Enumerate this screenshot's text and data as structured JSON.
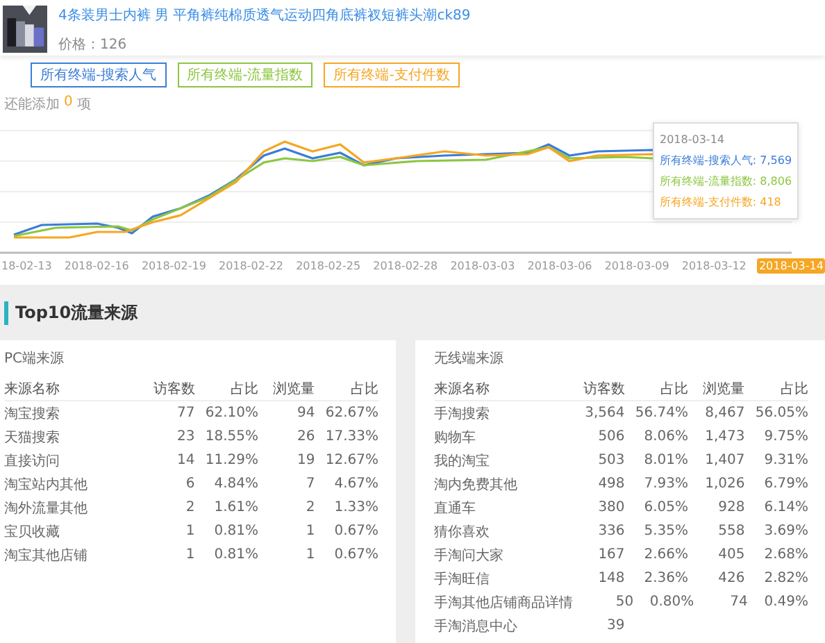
{
  "product": {
    "title": "4条装男士内裤 男 平角裤纯棉质透气运动四角底裤衩短裤头潮ck89",
    "price": "价格：126"
  },
  "legend": {
    "items": [
      {
        "label": "所有终端-搜索人气",
        "color": "#3b7dd8"
      },
      {
        "label": "所有终端-流量指数",
        "color": "#8cc63f"
      },
      {
        "label": "所有终端-支付件数",
        "color": "#f5a623"
      }
    ],
    "remaining_prefix": "还能添加",
    "remaining_count": "0",
    "remaining_suffix": "项"
  },
  "chart": {
    "x_labels": [
      {
        "label": "18-02-13",
        "selected": false
      },
      {
        "label": "2018-02-16",
        "selected": false
      },
      {
        "label": "2018-02-19",
        "selected": false
      },
      {
        "label": "2018-02-22",
        "selected": false
      },
      {
        "label": "2018-02-25",
        "selected": false
      },
      {
        "label": "2018-02-28",
        "selected": false
      },
      {
        "label": "2018-03-03",
        "selected": false
      },
      {
        "label": "2018-03-06",
        "selected": false
      },
      {
        "label": "2018-03-09",
        "selected": false
      },
      {
        "label": "2018-03-12",
        "selected": false
      },
      {
        "label": "2018-03-14",
        "selected": true
      }
    ],
    "tooltip": {
      "date": "2018-03-14",
      "entries": [
        {
          "text": "所有终端-搜索人气: 7,569",
          "color": "#3b7dd8"
        },
        {
          "text": "所有终端-流量指数: 8,806",
          "color": "#8cc63f"
        },
        {
          "text": "所有终端-支付件数: 418",
          "color": "#f5a623"
        }
      ]
    }
  },
  "section_title": "Top10流量来源",
  "tables": [
    {
      "title": "PC端来源",
      "columns": [
        "来源名称",
        "访客数",
        "占比",
        "浏览量",
        "占比"
      ],
      "rows": [
        [
          "淘宝搜索",
          "77",
          "62.10%",
          "94",
          "62.67%"
        ],
        [
          "天猫搜索",
          "23",
          "18.55%",
          "26",
          "17.33%"
        ],
        [
          "直接访问",
          "14",
          "11.29%",
          "19",
          "12.67%"
        ],
        [
          "淘宝站内其他",
          "6",
          "4.84%",
          "7",
          "4.67%"
        ],
        [
          "淘外流量其他",
          "2",
          "1.61%",
          "2",
          "1.33%"
        ],
        [
          "宝贝收藏",
          "1",
          "0.81%",
          "1",
          "0.67%"
        ],
        [
          "淘宝其他店铺",
          "1",
          "0.81%",
          "1",
          "0.67%"
        ]
      ]
    },
    {
      "title": "无线端来源",
      "columns": [
        "来源名称",
        "访客数",
        "占比",
        "浏览量",
        "占比"
      ],
      "rows": [
        [
          "手淘搜索",
          "3,564",
          "56.74%",
          "8,467",
          "56.05%"
        ],
        [
          "购物车",
          "506",
          "8.06%",
          "1,473",
          "9.75%"
        ],
        [
          "我的淘宝",
          "503",
          "8.01%",
          "1,407",
          "9.31%"
        ],
        [
          "淘内免费其他",
          "498",
          "7.93%",
          "1,026",
          "6.79%"
        ],
        [
          "直通车",
          "380",
          "6.05%",
          "928",
          "6.14%"
        ],
        [
          "猜你喜欢",
          "336",
          "5.35%",
          "558",
          "3.69%"
        ],
        [
          "手淘问大家",
          "167",
          "2.66%",
          "405",
          "2.68%"
        ],
        [
          "手淘旺信",
          "148",
          "2.36%",
          "426",
          "2.82%"
        ],
        [
          "手淘其他店铺商品详情",
          "50",
          "0.80%",
          "74",
          "0.49%"
        ],
        [
          "手淘消息中心",
          "39"
        ]
      ]
    }
  ]
}
